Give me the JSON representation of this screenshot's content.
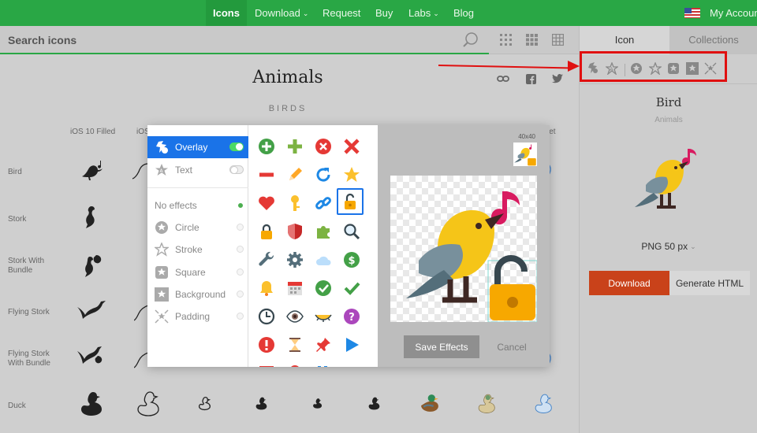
{
  "nav": {
    "items": [
      {
        "label": "Icons",
        "active": true
      },
      {
        "label": "Download",
        "caret": true
      },
      {
        "label": "Request"
      },
      {
        "label": "Buy"
      },
      {
        "label": "Labs",
        "caret": true
      },
      {
        "label": "Blog"
      }
    ],
    "account": "My Account"
  },
  "search": {
    "placeholder": "Search icons",
    "value": ""
  },
  "category": {
    "title": "Animals",
    "subcategory": "BIRDS"
  },
  "style_headers": [
    "iOS 10 Filled",
    "iOS",
    "let"
  ],
  "rows": [
    {
      "label": "Bird"
    },
    {
      "label": "Stork"
    },
    {
      "label": "Stork With Bundle"
    },
    {
      "label": "Flying Stork"
    },
    {
      "label": "Flying Stork With Bundle"
    },
    {
      "label": "Duck"
    }
  ],
  "panel": {
    "tabs": [
      {
        "label": "Icon",
        "active": true
      },
      {
        "label": "Collections"
      }
    ],
    "icon_name": "Bird",
    "icon_category": "Animals",
    "format": "PNG 50 px",
    "download_label": "Download",
    "generate_label": "Generate HTML"
  },
  "modal": {
    "effects_top": [
      {
        "label": "Overlay",
        "active": true,
        "toggle": "on"
      },
      {
        "label": "Text",
        "toggle": "off"
      }
    ],
    "effects_list": [
      {
        "label": "No effects",
        "selected": true
      },
      {
        "label": "Circle"
      },
      {
        "label": "Stroke"
      },
      {
        "label": "Square"
      },
      {
        "label": "Background"
      },
      {
        "label": "Padding"
      }
    ],
    "size_label": "40x40",
    "save_label": "Save Effects",
    "cancel_label": "Cancel"
  },
  "colors": {
    "brand_green": "#29a745",
    "download_orange": "#c9421a",
    "highlight_red": "#e01010",
    "selection_blue": "#1a73e8",
    "bird_yellow": "#f5c518",
    "lock_orange": "#f7a800"
  }
}
